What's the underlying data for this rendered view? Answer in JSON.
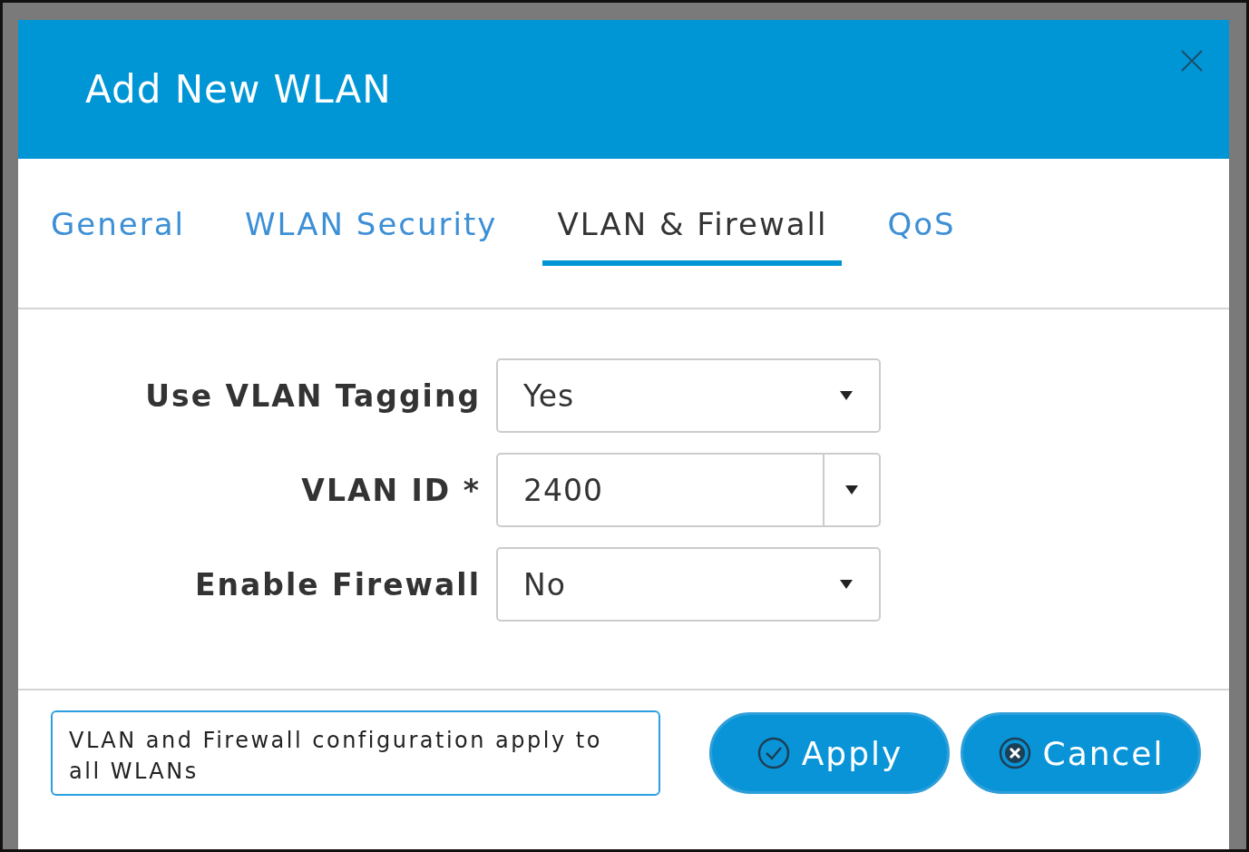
{
  "dialog": {
    "title": "Add New WLAN"
  },
  "tabs": [
    {
      "label": "General",
      "selected": false
    },
    {
      "label": "WLAN Security",
      "selected": false
    },
    {
      "label": "VLAN & Firewall",
      "selected": true
    },
    {
      "label": "QoS",
      "selected": false
    }
  ],
  "fields": [
    {
      "label": "Use VLAN Tagging",
      "kind": "select",
      "value": "Yes"
    },
    {
      "label": "VLAN ID *",
      "kind": "combo",
      "value": "2400"
    },
    {
      "label": "Enable Firewall",
      "kind": "select",
      "value": "No"
    }
  ],
  "note": "VLAN and Firewall configuration apply to all WLANs",
  "buttons": [
    {
      "label": "Apply",
      "kind": "apply"
    },
    {
      "label": "Cancel",
      "kind": "cancel"
    }
  ]
}
